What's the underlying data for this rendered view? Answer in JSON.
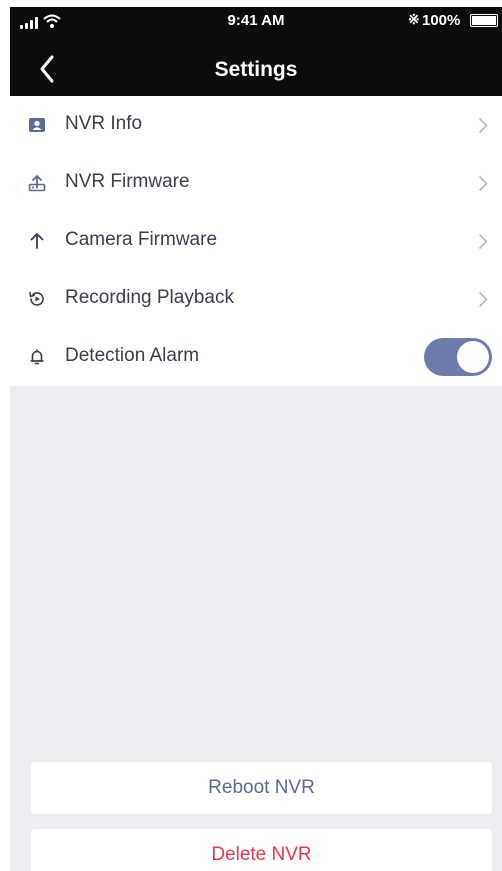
{
  "status_bar": {
    "time": "9:41 AM",
    "battery_text": "100%",
    "icons": [
      "signal-icon",
      "wifi-icon",
      "bluetooth-icon",
      "battery-icon"
    ]
  },
  "nav": {
    "title": "Settings",
    "back_icon": "chevron-left-icon"
  },
  "menu": {
    "items": [
      {
        "label": "NVR Info",
        "icon": "nvr-info-icon",
        "trailing": "chevron"
      },
      {
        "label": "NVR Firmware",
        "icon": "upload-icon",
        "trailing": "chevron"
      },
      {
        "label": "Camera Firmware",
        "icon": "arrow-up-icon",
        "trailing": "chevron"
      },
      {
        "label": "Recording Playback",
        "icon": "playback-icon",
        "trailing": "chevron"
      },
      {
        "label": "Detection Alarm",
        "icon": "bell-icon",
        "trailing": "toggle",
        "toggle_on": true
      }
    ]
  },
  "actions": {
    "reboot_label": "Reboot NVR",
    "delete_label": "Delete NVR"
  },
  "colors": {
    "nav_background": "#0c0c0c",
    "page_background": "#edecf1",
    "toggle_on": "#6e7cac",
    "reboot_text": "#5c6a96",
    "delete_text": "#e03a4c"
  }
}
